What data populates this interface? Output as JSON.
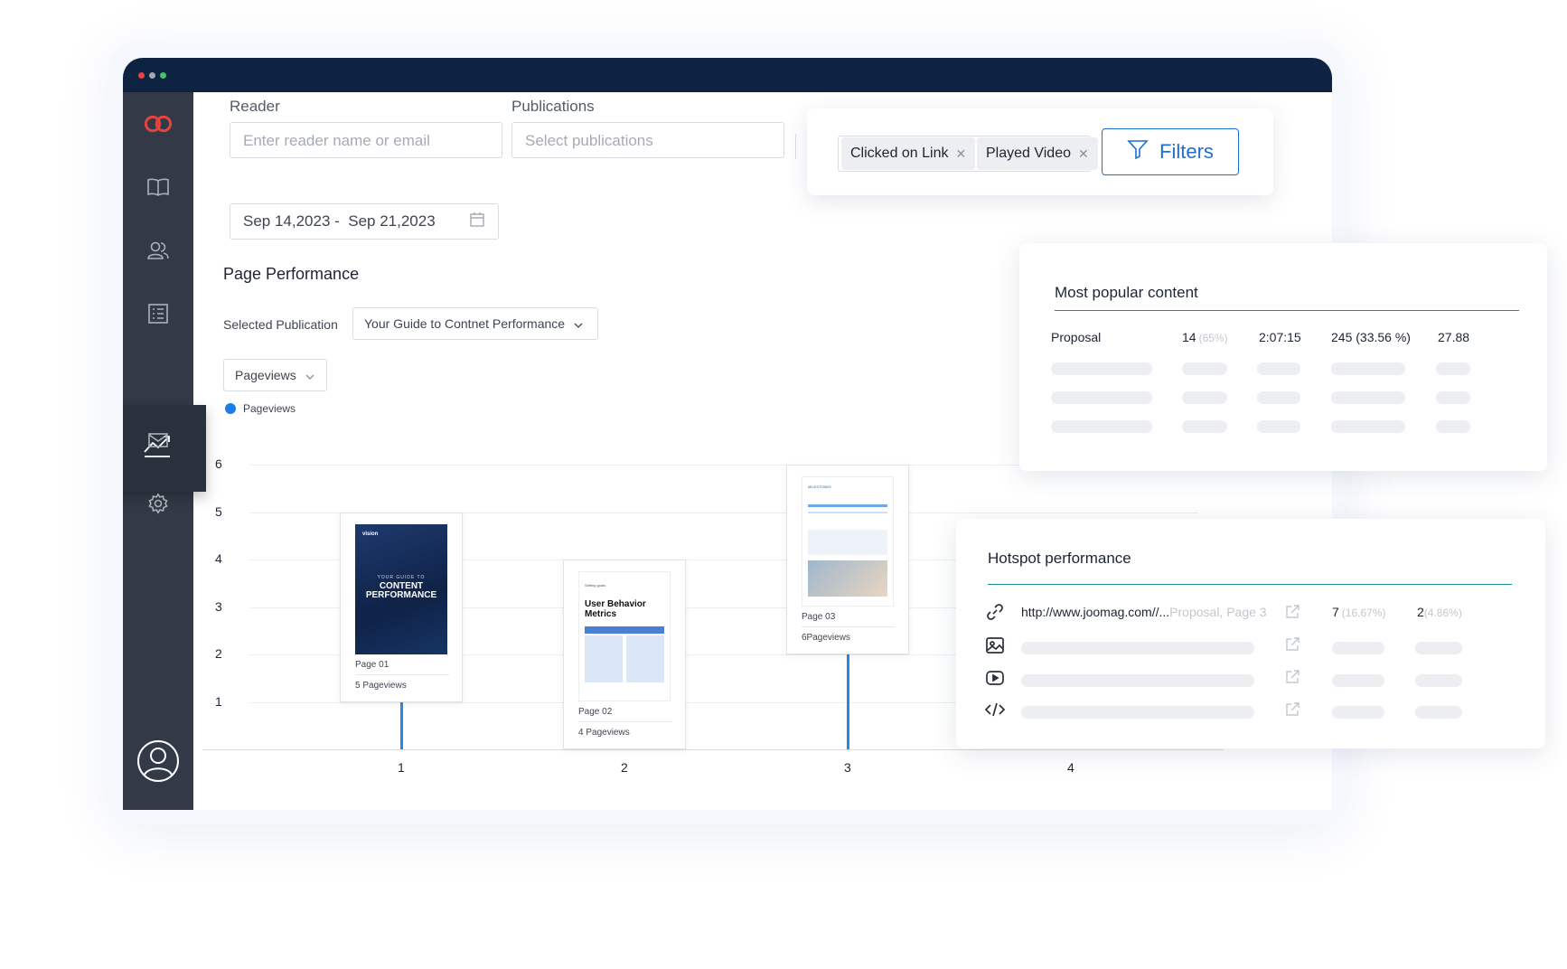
{
  "colors": {
    "titlebar": "#0e2341",
    "sidebar": "#323a47",
    "accent_blue": "#1f6fd1",
    "stem_blue": "#2a87e6",
    "teal": "#1f8a9a",
    "logo_red": "#e8423f"
  },
  "window": {
    "dots": [
      "#e8423f",
      "#a3a9b3",
      "#45c463"
    ]
  },
  "sidebar": {
    "items": [
      {
        "icon": "logo-icon"
      },
      {
        "icon": "book-icon"
      },
      {
        "icon": "users-icon"
      },
      {
        "icon": "list-icon"
      },
      {
        "icon": "analytics-icon",
        "active": true
      },
      {
        "icon": "mail-icon"
      },
      {
        "icon": "settings-icon"
      },
      {
        "icon": "profile-icon"
      }
    ]
  },
  "filters": {
    "reader_label": "Reader",
    "reader_placeholder": "Enter reader name or email",
    "publications_label": "Publications",
    "publications_placeholder": "Select publications",
    "date_range": "Sep 14,2023 -  Sep 21,2023",
    "chips": [
      "Clicked on Link",
      "Played Video"
    ],
    "filters_button": "Filters"
  },
  "page_performance": {
    "title": "Page Performance",
    "selected_publication_label": "Selected Publication",
    "selected_publication_value": "Your Guide to Contnet Performance",
    "metric_select": "Pageviews",
    "legend": "Pageviews"
  },
  "chart_data": {
    "type": "bar",
    "categories": [
      "1",
      "2",
      "3",
      "4"
    ],
    "series": [
      {
        "name": "Pageviews",
        "values": [
          5,
          4,
          6,
          null
        ]
      }
    ],
    "yticks": [
      "6",
      "5",
      "4",
      "3",
      "2",
      "1"
    ],
    "ylim": [
      0,
      6
    ],
    "grid": true,
    "legend_position": "top-left",
    "pages": [
      {
        "page": "Page 01",
        "views": "5 Pageviews",
        "cover": {
          "line1": "YOUR GUIDE TO",
          "line2": "CONTENT",
          "line3": "PERFORMANCE",
          "brand": "vision"
        }
      },
      {
        "page": "Page 02",
        "views": "4 Pageviews",
        "cover": {
          "heading1": "User Behavior",
          "heading2": "Metrics",
          "kicker": "Setting goals"
        }
      },
      {
        "page": "Page 03",
        "views": "6Pageviews",
        "cover": {
          "heading1": "MILESTONES"
        }
      }
    ]
  },
  "popular": {
    "title": "Most popular content",
    "row": {
      "name": "Proposal",
      "count": "14",
      "count_pct": "(65%)",
      "time": "2:07:15",
      "views": "245 (33.56 %)",
      "score": "27.88"
    }
  },
  "hotspot": {
    "title": "Hotspot performance",
    "row": {
      "url": "http://www.joomag.com//...",
      "location": "Proposal, Page 3",
      "clicks": "7",
      "clicks_pct": "(16.67%)",
      "unique": "2",
      "unique_pct": "(4.86%)"
    },
    "icons": [
      "link-icon",
      "image-icon",
      "video-icon",
      "code-icon"
    ]
  }
}
